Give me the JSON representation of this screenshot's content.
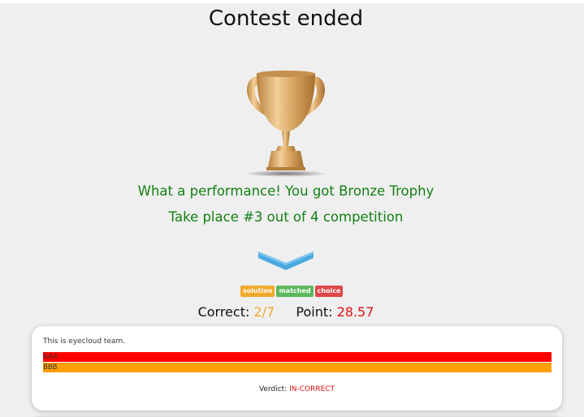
{
  "title": "Contest ended",
  "trophy": {
    "icon": "bronze-trophy-icon",
    "color": "#d9a866"
  },
  "messages": {
    "performance": "What a performance! You got Bronze Trophy",
    "placement": "Take place #3 out of 4 competition"
  },
  "legend": {
    "solution": "solution",
    "matched": "matched",
    "choice": "choice"
  },
  "score": {
    "correct_label": "Correct:",
    "correct_value": "2/7",
    "point_label": "Point:",
    "point_value": "28.57"
  },
  "question": {
    "text": "This is eyecloud team.",
    "options": [
      {
        "label": "AAA",
        "color": "#ff0000"
      },
      {
        "label": "BBB",
        "color": "#ff9f00"
      }
    ],
    "verdict_label": "Verdict:",
    "verdict_value": "IN-CORRECT"
  },
  "colors": {
    "green_text": "#138013",
    "orange": "#f0a92a",
    "red": "#e01010",
    "chevron_blue": "#4aa8e0"
  }
}
